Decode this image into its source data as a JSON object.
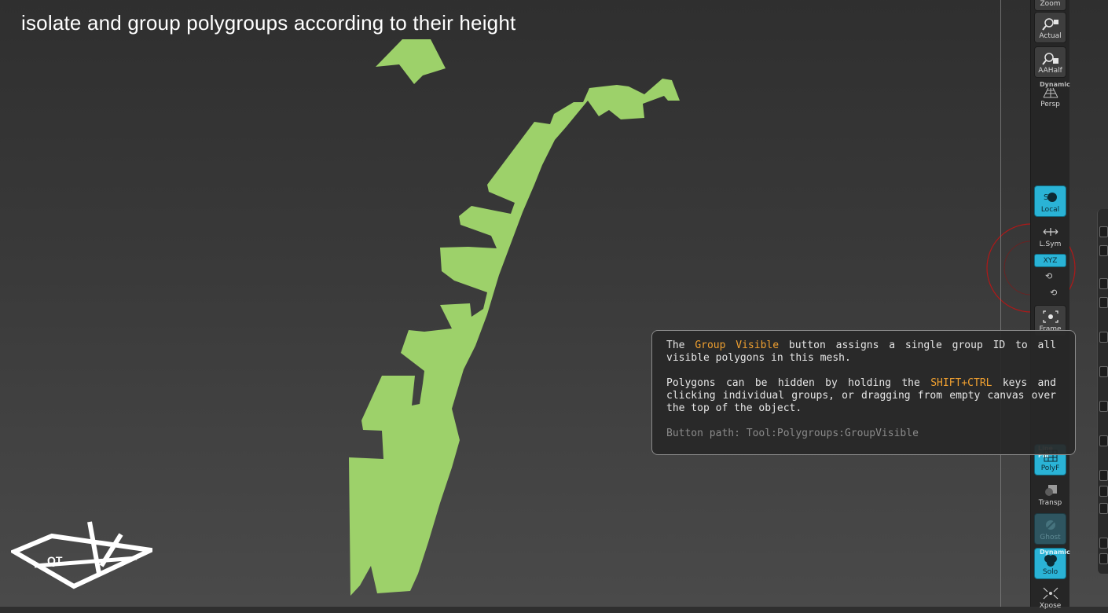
{
  "caption": "isolate and group polygroups according to their height",
  "colors": {
    "mesh": "#9dd16a",
    "accent_active": "#2ab3d6",
    "highlight": "#f0a030",
    "gizmo": "#b01818"
  },
  "shelf": {
    "zoom_label": "Zoom",
    "actual_label": "Actual",
    "aahalf_label": "AAHalf",
    "persp_top": "Dynamic",
    "persp_label": "Persp",
    "local_label": "Local",
    "lsym_label": "L.Sym",
    "xyz_label": "XYZ",
    "frame_label": "Frame",
    "polyf_top": "Line Fill",
    "polyf_label": "PolyF",
    "transp_label": "Transp",
    "ghost_label": "Ghost",
    "solo_top": "Dynamic",
    "solo_label": "Solo",
    "xpose_label": "Xpose"
  },
  "tooltip": {
    "line1_pre": "The",
    "line1_hl": "Group Visible",
    "line1_post": "button assigns a single group ID to all visible polygons in this mesh.",
    "line2_pre": "Polygons can be hidden by holding the",
    "line2_hl": "SHIFT+CTRL",
    "line2_post": "keys and clicking individual groups, or dragging from empty canvas over the top of the object.",
    "path": "Button path: Tool:Polygroups:GroupVisible"
  },
  "logo_text": "QT"
}
